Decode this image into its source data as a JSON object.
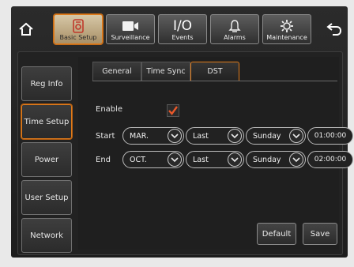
{
  "top_tabs": [
    {
      "label": "Basic Setup",
      "icon": "settings-doc-icon",
      "active": true
    },
    {
      "label": "Surveillance",
      "icon": "video-camera-icon",
      "active": false
    },
    {
      "label": "Events",
      "icon": "io-icon",
      "icon_text": "I/O",
      "active": false
    },
    {
      "label": "Alarms",
      "icon": "bell-icon",
      "active": false
    },
    {
      "label": "Maintenance",
      "icon": "gear-wrench-icon",
      "active": false
    }
  ],
  "sidebar": [
    {
      "label": "Reg Info",
      "active": false
    },
    {
      "label": "Time Setup",
      "active": true
    },
    {
      "label": "Power",
      "active": false
    },
    {
      "label": "User Setup",
      "active": false
    },
    {
      "label": "Network",
      "active": false
    }
  ],
  "sub_tabs": [
    {
      "label": "General",
      "active": false
    },
    {
      "label": "Time Sync",
      "active": false
    },
    {
      "label": "DST",
      "active": true
    }
  ],
  "dst": {
    "enable_label": "Enable",
    "enabled": true,
    "start": {
      "label": "Start",
      "month": "MAR.",
      "week": "Last",
      "day": "Sunday",
      "time": "01:00:00"
    },
    "end": {
      "label": "End",
      "month": "OCT.",
      "week": "Last",
      "day": "Sunday",
      "time": "02:00:00"
    }
  },
  "buttons": {
    "default_label": "Default",
    "save_label": "Save"
  },
  "colors": {
    "accent": "#e07b1b",
    "check": "#e8582a"
  }
}
